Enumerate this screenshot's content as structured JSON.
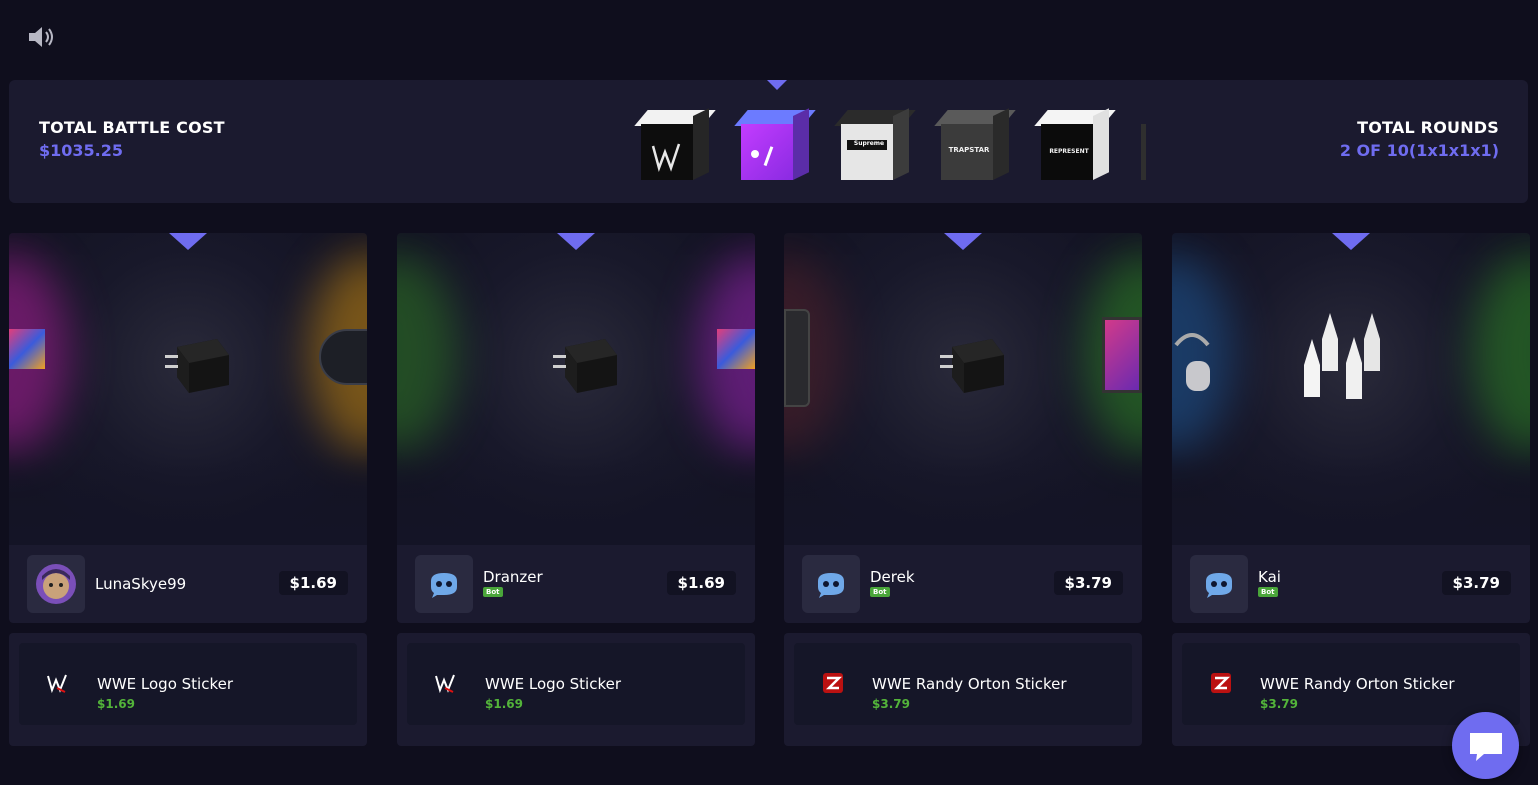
{
  "sound": {
    "icon": "speaker-icon"
  },
  "battle": {
    "cost_label": "TOTAL BATTLE COST",
    "cost_value": "$1035.25",
    "rounds_label": "TOTAL ROUNDS",
    "rounds_value": "2 OF 10(1x1x1x1)",
    "accent_color": "#6f6cf0"
  },
  "cases": [
    {
      "name": "wwe-case",
      "text": ""
    },
    {
      "name": "apple-case",
      "text": ""
    },
    {
      "name": "supreme-case",
      "text": "Supreme"
    },
    {
      "name": "trapstar-case",
      "text": "TRAPSTAR"
    },
    {
      "name": "represent-case",
      "text": "REPRESENT"
    }
  ],
  "players": [
    {
      "name": "LunaSkye99",
      "is_bot": false,
      "price": "$1.69",
      "current_item": "charger",
      "win_item": {
        "name": "WWE Logo Sticker",
        "price": "$1.69",
        "icon": "wwe-logo-icon"
      }
    },
    {
      "name": "Dranzer",
      "is_bot": true,
      "bot_label": "Bot",
      "price": "$1.69",
      "current_item": "charger",
      "win_item": {
        "name": "WWE Logo Sticker",
        "price": "$1.69",
        "icon": "wwe-logo-icon"
      }
    },
    {
      "name": "Derek",
      "is_bot": true,
      "bot_label": "Bot",
      "price": "$3.79",
      "current_item": "charger",
      "win_item": {
        "name": "WWE Randy Orton Sticker",
        "price": "$3.79",
        "icon": "randy-orton-icon"
      }
    },
    {
      "name": "Kai",
      "is_bot": true,
      "bot_label": "Bot",
      "price": "$3.79",
      "current_item": "pencil-tips",
      "win_item": {
        "name": "WWE Randy Orton Sticker",
        "price": "$3.79",
        "icon": "randy-orton-icon"
      }
    }
  ],
  "chat": {
    "icon": "chat-icon"
  }
}
